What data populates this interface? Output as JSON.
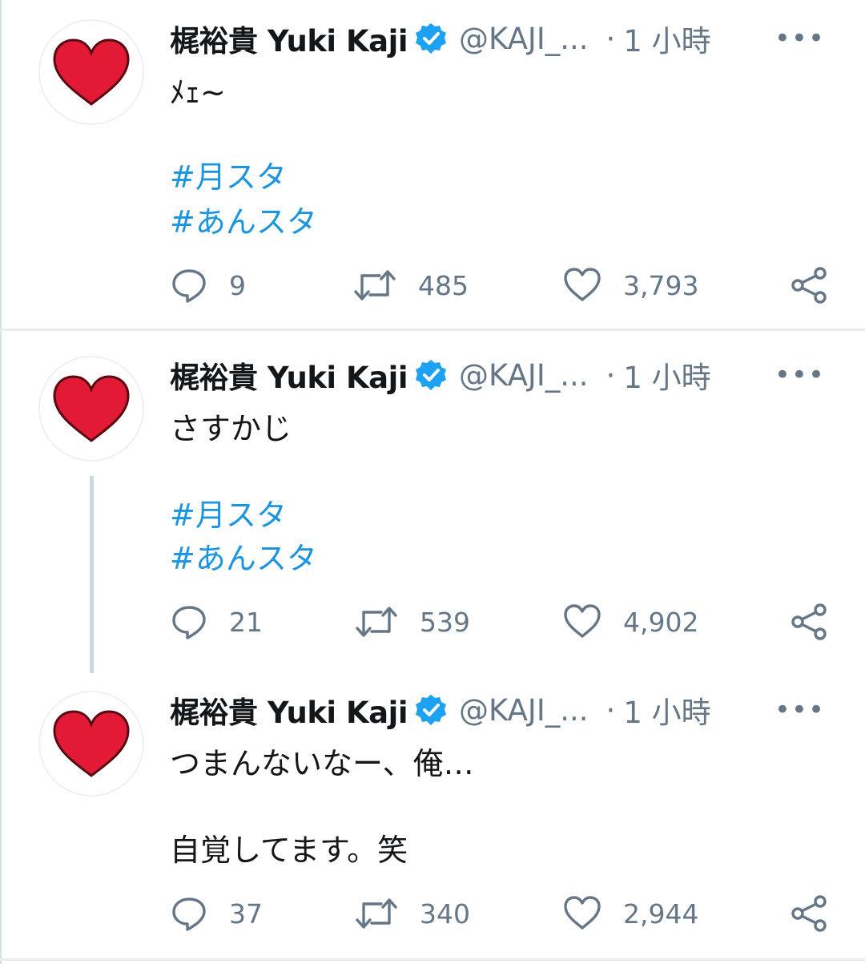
{
  "tweets": [
    {
      "display_name": "梶裕貴 Yuki Kaji",
      "handle": "@KAJI_...",
      "dot": "·",
      "time": "1 小時",
      "more": "•••",
      "lines": [
        "ﾒｪ~",
        "",
        "",
        "#月スタ",
        "#あんスタ"
      ],
      "replies": "9",
      "retweets": "485",
      "likes": "3,793"
    },
    {
      "display_name": "梶裕貴 Yuki Kaji",
      "handle": "@KAJI_...",
      "dot": "·",
      "time": "1 小時",
      "more": "•••",
      "lines": [
        "さすかじ",
        "",
        "",
        "#月スタ",
        "#あんスタ"
      ],
      "replies": "21",
      "retweets": "539",
      "likes": "4,902"
    },
    {
      "display_name": "梶裕貴 Yuki Kaji",
      "handle": "@KAJI_...",
      "dot": "·",
      "time": "1 小時",
      "more": "•••",
      "lines": [
        "つまんないなー、俺…",
        "",
        "自覚してます。笑"
      ],
      "replies": "37",
      "retweets": "340",
      "likes": "2,944"
    }
  ],
  "colors": {
    "hashtag": "#1b95e0",
    "verified": "#1da1f2",
    "muted": "#657786",
    "heart_avatar": "#e21a35"
  },
  "icons": {
    "reply": "reply-icon",
    "retweet": "retweet-icon",
    "like": "like-icon",
    "share": "share-icon",
    "verified": "verified-badge-icon"
  }
}
